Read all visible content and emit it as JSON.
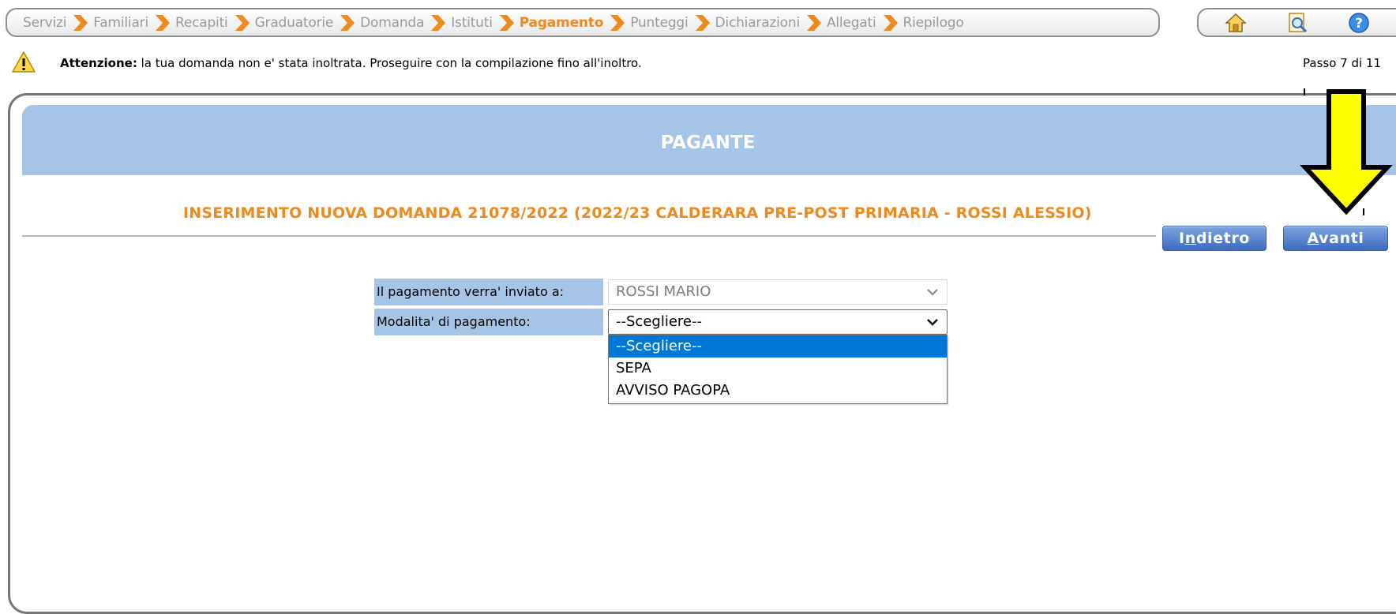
{
  "breadcrumb": [
    {
      "label": "Servizi",
      "active": false
    },
    {
      "label": "Familiari",
      "active": false
    },
    {
      "label": "Recapiti",
      "active": false
    },
    {
      "label": "Graduatorie",
      "active": false
    },
    {
      "label": "Domanda",
      "active": false
    },
    {
      "label": "Istituti",
      "active": false
    },
    {
      "label": "Pagamento",
      "active": true
    },
    {
      "label": "Punteggi",
      "active": false
    },
    {
      "label": "Dichiarazioni",
      "active": false
    },
    {
      "label": "Allegati",
      "active": false
    },
    {
      "label": "Riepilogo",
      "active": false
    }
  ],
  "toolbar_icons": [
    "home-icon",
    "search-document-icon",
    "help-icon"
  ],
  "warning": {
    "icon": "warning-triangle-icon",
    "label_bold": "Attenzione:",
    "message": " la tua domanda non e' stata inoltrata. Proseguire con la compilazione fino all'inoltro."
  },
  "step": "Passo 7 di 11",
  "header": {
    "title": "PAGANTE",
    "subtitle": "INSERIMENTO NUOVA DOMANDA 21078/2022 (2022/23 CALDERARA PRE-POST PRIMARIA - ROSSI ALESSIO)"
  },
  "buttons": {
    "back": {
      "pre": "I",
      "underlined": "n",
      "post": "dietro"
    },
    "next": {
      "pre": "",
      "underlined": "A",
      "post": "vanti"
    }
  },
  "form": {
    "payer_label": "Il pagamento verra' inviato a:",
    "payer_value": "ROSSI MARIO",
    "mode_label": "Modalita' di pagamento:",
    "mode_value": "--Scegliere--",
    "mode_options": [
      "--Scegliere--",
      "SEPA",
      "AVVISO PAGOPA"
    ],
    "mode_selected_index": 0
  },
  "colors": {
    "accent_orange": "#f08a1c",
    "header_blue": "#a6c4e6",
    "button_blue": "#3d6bbf",
    "highlight_arrow": "#ffff00",
    "option_selected": "#0078d7"
  }
}
